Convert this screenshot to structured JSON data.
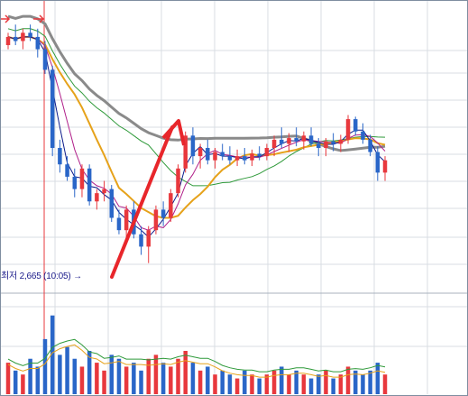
{
  "chart_data": {
    "type": "candlestick",
    "low_marker": {
      "label": "최저 2,665 (10:05)"
    },
    "colors": {
      "up": "#e8383d",
      "down": "#2a66c8",
      "grid": "#d9dde3",
      "ma_short": "#0b1a8a",
      "ma_mid": "#b0208a",
      "ma_orange": "#e6a21a",
      "ma_green": "#2f9a3a",
      "ma_long": "#8a8a8a",
      "trend_arrow": "#e8262b",
      "vertical_marker": "#e8383d",
      "volume_green": "#2f9a3a",
      "volume_orange": "#e6a21a"
    },
    "candles": [
      [
        2935,
        2950,
        2930,
        2945
      ],
      [
        2945,
        2960,
        2935,
        2940
      ],
      [
        2940,
        2955,
        2930,
        2950
      ],
      [
        2950,
        2960,
        2940,
        2945
      ],
      [
        2945,
        2955,
        2920,
        2930
      ],
      [
        2930,
        2940,
        2900,
        2905
      ],
      [
        2905,
        2910,
        2800,
        2810
      ],
      [
        2810,
        2820,
        2780,
        2790
      ],
      [
        2790,
        2800,
        2770,
        2775
      ],
      [
        2775,
        2785,
        2750,
        2760
      ],
      [
        2760,
        2790,
        2750,
        2785
      ],
      [
        2785,
        2790,
        2740,
        2745
      ],
      [
        2745,
        2760,
        2735,
        2755
      ],
      [
        2755,
        2770,
        2745,
        2760
      ],
      [
        2760,
        2765,
        2720,
        2725
      ],
      [
        2725,
        2735,
        2705,
        2710
      ],
      [
        2710,
        2740,
        2700,
        2735
      ],
      [
        2735,
        2745,
        2700,
        2705
      ],
      [
        2705,
        2715,
        2680,
        2690
      ],
      [
        2690,
        2715,
        2670,
        2710
      ],
      [
        2710,
        2740,
        2705,
        2735
      ],
      [
        2735,
        2745,
        2715,
        2725
      ],
      [
        2725,
        2760,
        2720,
        2755
      ],
      [
        2755,
        2790,
        2750,
        2785
      ],
      [
        2785,
        2830,
        2780,
        2825
      ],
      [
        2825,
        2835,
        2790,
        2800
      ],
      [
        2800,
        2815,
        2785,
        2810
      ],
      [
        2810,
        2820,
        2790,
        2795
      ],
      [
        2795,
        2810,
        2785,
        2805
      ],
      [
        2805,
        2815,
        2795,
        2800
      ],
      [
        2800,
        2812,
        2790,
        2795
      ],
      [
        2795,
        2808,
        2788,
        2800
      ],
      [
        2800,
        2810,
        2790,
        2795
      ],
      [
        2795,
        2808,
        2788,
        2803
      ],
      [
        2803,
        2812,
        2795,
        2800
      ],
      [
        2800,
        2815,
        2795,
        2810
      ],
      [
        2810,
        2825,
        2800,
        2820
      ],
      [
        2820,
        2835,
        2810,
        2815
      ],
      [
        2815,
        2828,
        2805,
        2822
      ],
      [
        2822,
        2835,
        2812,
        2818
      ],
      [
        2818,
        2830,
        2808,
        2825
      ],
      [
        2825,
        2835,
        2812,
        2815
      ],
      [
        2815,
        2822,
        2800,
        2810
      ],
      [
        2810,
        2822,
        2800,
        2818
      ],
      [
        2818,
        2828,
        2806,
        2815
      ],
      [
        2815,
        2826,
        2805,
        2820
      ],
      [
        2820,
        2850,
        2815,
        2845
      ],
      [
        2845,
        2848,
        2825,
        2830
      ],
      [
        2830,
        2840,
        2815,
        2820
      ],
      [
        2820,
        2826,
        2800,
        2805
      ],
      [
        2805,
        2812,
        2770,
        2780
      ],
      [
        2780,
        2800,
        2770,
        2795
      ]
    ],
    "volume": [
      8,
      6,
      5,
      9,
      7,
      14,
      20,
      10,
      12,
      9,
      7,
      11,
      8,
      6,
      10,
      9,
      7,
      8,
      6,
      9,
      10,
      8,
      7,
      9,
      11,
      8,
      6,
      7,
      5,
      6,
      5,
      4,
      6,
      5,
      4,
      5,
      6,
      7,
      5,
      6,
      5,
      4,
      5,
      6,
      4,
      5,
      7,
      6,
      5,
      6,
      8,
      5
    ]
  }
}
